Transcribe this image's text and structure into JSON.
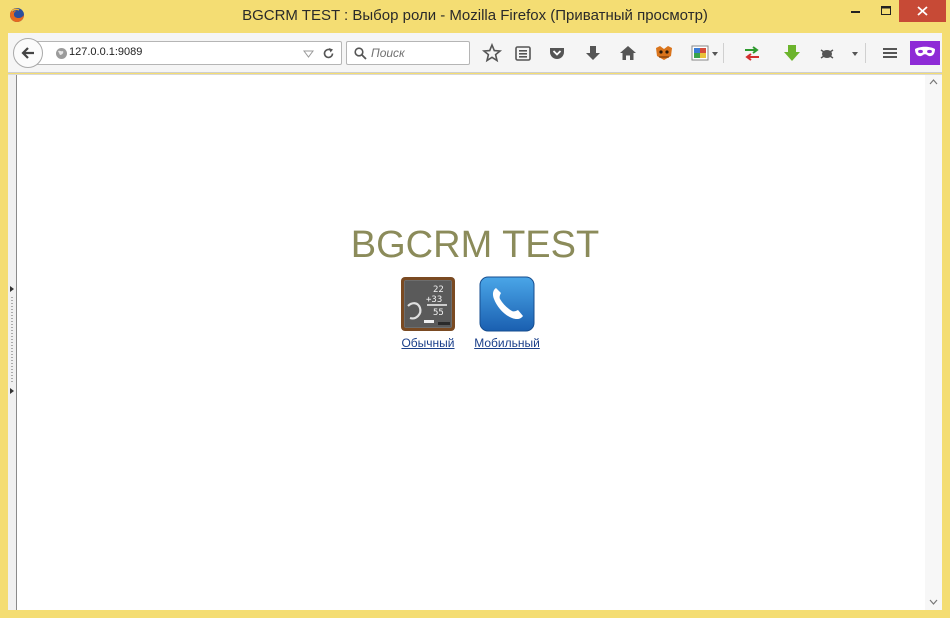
{
  "window": {
    "title": "BGCRM TEST : Выбор роли - Mozilla Firefox (Приватный просмотр)"
  },
  "toolbar": {
    "url": "127.0.0.1:9089",
    "search_placeholder": "Поиск"
  },
  "page": {
    "title": "BGCRM TEST",
    "roles": [
      {
        "label": "Обычный",
        "icon": "chalkboard-math-icon"
      },
      {
        "label": "Мобильный",
        "icon": "phone-icon"
      }
    ]
  },
  "colors": {
    "window_frame": "#f4dd73",
    "close_button": "#c74a36",
    "title_text": "#8b8b5a",
    "link": "#1a3f8a",
    "private_mask": "#8e2bd6"
  }
}
